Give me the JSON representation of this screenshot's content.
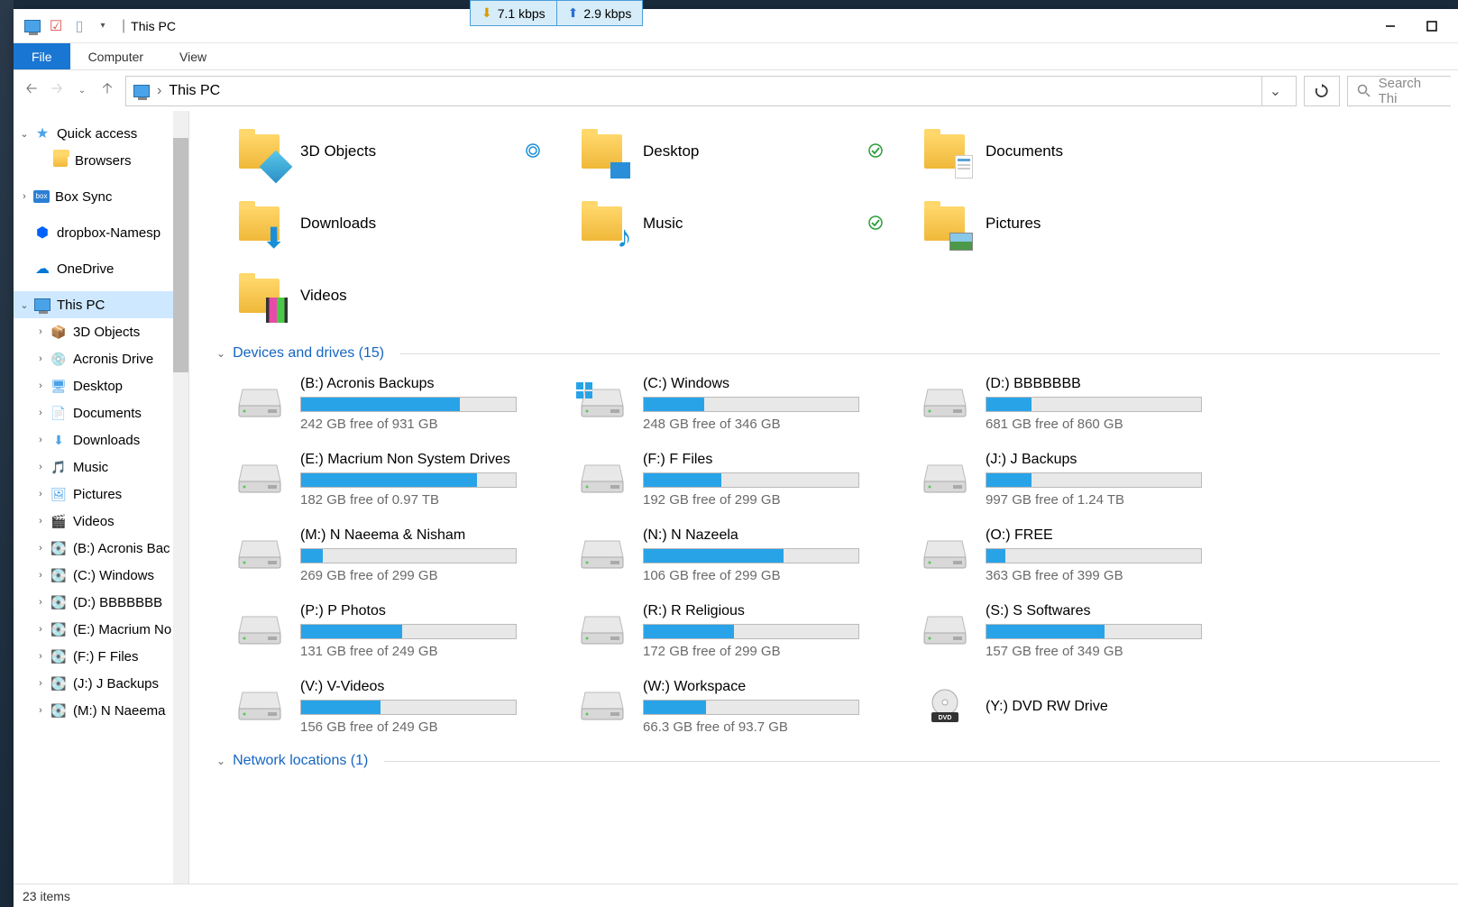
{
  "net": {
    "down": "7.1 kbps",
    "up": "2.9 kbps"
  },
  "title": "This PC",
  "tabs": {
    "file": "File",
    "computer": "Computer",
    "view": "View"
  },
  "breadcrumb": "This PC",
  "search_placeholder": "Search Thi",
  "sidebar": {
    "quick_access": "Quick access",
    "browsers": "Browsers",
    "box_sync": "Box Sync",
    "dropbox": "dropbox-Namesp",
    "onedrive": "OneDrive",
    "this_pc": "This PC",
    "items": [
      "3D Objects",
      "Acronis Drive",
      "Desktop",
      "Documents",
      "Downloads",
      "Music",
      "Pictures",
      "Videos",
      "(B:) Acronis Bac",
      "(C:) Windows",
      "(D:) BBBBBBB",
      "(E:) Macrium No",
      "(F:) F Files",
      "(J:)  J Backups",
      "(M:) N Naeema"
    ]
  },
  "folders": [
    {
      "name": "3D Objects",
      "badge": "sync"
    },
    {
      "name": "Desktop",
      "badge": "ok"
    },
    {
      "name": "Documents",
      "badge": null
    },
    {
      "name": "Downloads",
      "badge": null
    },
    {
      "name": "Music",
      "badge": "ok"
    },
    {
      "name": "Pictures",
      "badge": null
    },
    {
      "name": "Videos",
      "badge": null
    }
  ],
  "section_drives": "Devices and drives (15)",
  "drives": [
    {
      "name": "(B:) Acronis Backups",
      "free": "242 GB free of 931 GB",
      "used_pct": 74
    },
    {
      "name": "(C:) Windows",
      "free": "248 GB free of 346 GB",
      "used_pct": 28,
      "os": true
    },
    {
      "name": "(D:) BBBBBBB",
      "free": "681 GB free of 860 GB",
      "used_pct": 21
    },
    {
      "name": "(E:) Macrium Non System Drives",
      "free": "182 GB free of 0.97 TB",
      "used_pct": 82
    },
    {
      "name": "(F:) F Files",
      "free": "192 GB free of 299 GB",
      "used_pct": 36
    },
    {
      "name": "(J:)  J Backups",
      "free": "997 GB free of 1.24 TB",
      "used_pct": 21
    },
    {
      "name": "(M:) N Naeema & Nisham",
      "free": "269 GB free of 299 GB",
      "used_pct": 10
    },
    {
      "name": "(N:) N Nazeela",
      "free": "106 GB free of 299 GB",
      "used_pct": 65
    },
    {
      "name": "(O:) FREE",
      "free": "363 GB free of 399 GB",
      "used_pct": 9
    },
    {
      "name": "(P:) P Photos",
      "free": "131 GB free of 249 GB",
      "used_pct": 47
    },
    {
      "name": "(R:) R Religious",
      "free": "172 GB free of 299 GB",
      "used_pct": 42
    },
    {
      "name": "(S:) S Softwares",
      "free": "157 GB free of 349 GB",
      "used_pct": 55
    },
    {
      "name": "(V:) V-Videos",
      "free": "156 GB free of 249 GB",
      "used_pct": 37
    },
    {
      "name": "(W:) Workspace",
      "free": "66.3 GB free of 93.7 GB",
      "used_pct": 29
    },
    {
      "name": "(Y:) DVD RW Drive",
      "free": "",
      "used_pct": null,
      "dvd": true
    }
  ],
  "section_network": "Network locations (1)",
  "status": "23 items"
}
